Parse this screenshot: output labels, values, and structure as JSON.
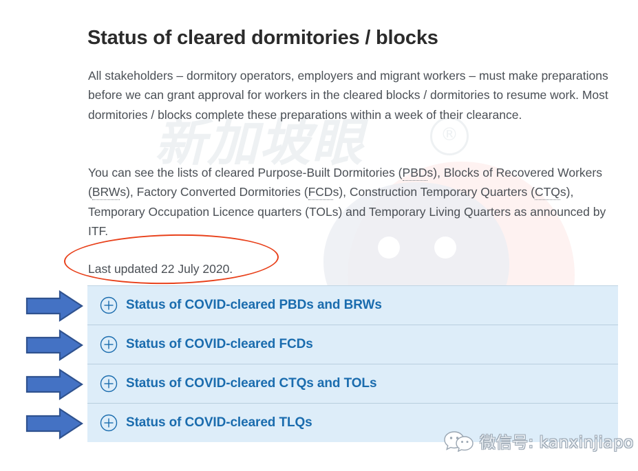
{
  "page": {
    "title": "Status of cleared dormitories / blocks",
    "paragraphs": [
      "All stakeholders – dormitory operators, employers and migrant workers – must make preparations before we can grant approval for workers in the cleared blocks / dormitories to resume work. Most dormitories / blocks complete these preparations within a week of their clearance.",
      "You can see the lists of cleared Purpose-Built Dormitories (PBDs), Blocks of Recovered Workers (BRWs), Factory Converted Dormitories (FCDs), Construction Temporary Quarters (CTQs), Temporary Occupation Licence quarters (TOLs) and Temporary Living Quarters as announced by ITF."
    ],
    "last_updated": "Last updated 22 July 2020."
  },
  "para2_parts": {
    "p1": "You can see the lists of cleared Purpose-Built Dormitories (",
    "abbr1": "PBD",
    "p2": "s), Blocks of Recovered Workers (",
    "abbr2": "BRW",
    "p3": "s), Factory Converted Dormitories (",
    "abbr3": "FCD",
    "p4": "s), Construction Temporary Quarters (",
    "abbr4": "CTQ",
    "p5": "s), Temporary Occupation Licence quarters (TOLs) and Temporary Living Quarters as announced by ITF."
  },
  "accordion": {
    "items": [
      {
        "label": "Status of COVID-cleared PBDs and BRWs",
        "icon": "plus-circle-icon"
      },
      {
        "label": "Status of COVID-cleared FCDs",
        "icon": "plus-circle-icon"
      },
      {
        "label": "Status of COVID-cleared CTQs and TOLs",
        "icon": "plus-circle-icon"
      },
      {
        "label": "Status of COVID-cleared TLQs",
        "icon": "plus-circle-icon"
      }
    ]
  },
  "annotations": {
    "ellipse": {
      "name": "red-ellipse-highlight",
      "color": "#e8401a"
    },
    "arrows": [
      {
        "name": "blue-arrow-1",
        "color": "#4472c4",
        "border": "#2f528f"
      },
      {
        "name": "blue-arrow-2",
        "color": "#4472c4",
        "border": "#2f528f"
      },
      {
        "name": "blue-arrow-3",
        "color": "#4472c4",
        "border": "#2f528f"
      },
      {
        "name": "blue-arrow-4",
        "color": "#4472c4",
        "border": "#2f528f"
      }
    ]
  },
  "watermarks": {
    "brand_cn": "新加坡眼",
    "registered_mark": "®",
    "wechat_label": "微信号: kanxinjiapo"
  },
  "colors": {
    "accordion_bg": "#ddedf9",
    "accordion_border": "#b8cede",
    "accordion_text": "#1a6cae",
    "body_text": "#4a4f55",
    "title_text": "#2b2b2b",
    "annotation_red": "#e8401a",
    "arrow_blue": "#4472c4"
  }
}
